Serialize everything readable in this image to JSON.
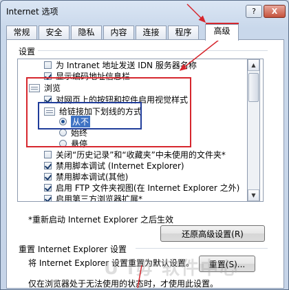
{
  "window": {
    "title": "Internet 选项",
    "help_glyph": "?",
    "close_glyph": "X"
  },
  "tabs": [
    {
      "label": "常规",
      "active": false
    },
    {
      "label": "安全",
      "active": false
    },
    {
      "label": "隐私",
      "active": false
    },
    {
      "label": "内容",
      "active": false
    },
    {
      "label": "连接",
      "active": false
    },
    {
      "label": "程序",
      "active": false
    },
    {
      "label": "高级",
      "active": true
    }
  ],
  "settings": {
    "label": "设置",
    "items": [
      {
        "type": "checkbox",
        "checked": false,
        "label": "为 Intranet 地址发送 IDN 服务器名称"
      },
      {
        "type": "checkbox",
        "checked": true,
        "label": "显示编码地址信息栏"
      },
      {
        "type": "group",
        "label": "浏览"
      },
      {
        "type": "checkbox",
        "checked": true,
        "label": "对网页上的按钮和控件启用视觉样式"
      },
      {
        "type": "group",
        "label": "给链接加下划线的方式"
      },
      {
        "type": "radio",
        "selected": true,
        "label": "从不"
      },
      {
        "type": "radio",
        "selected": false,
        "label": "始终"
      },
      {
        "type": "radio",
        "selected": false,
        "label": "悬停"
      },
      {
        "type": "checkbox",
        "checked": false,
        "label": "关闭“历史记录”和“收藏夹”中未使用的文件夹*"
      },
      {
        "type": "checkbox",
        "checked": true,
        "label": "禁用脚本调试 (Internet Explorer)"
      },
      {
        "type": "checkbox",
        "checked": true,
        "label": "禁用脚本调试(其他)"
      },
      {
        "type": "checkbox",
        "checked": true,
        "label": "启用 FTP 文件夹视图(在 Internet Explorer 之外)"
      },
      {
        "type": "checkbox",
        "checked": true,
        "label": "启用第三方浏览器扩展*"
      }
    ],
    "note": "*重新启动 Internet Explorer 之后生效",
    "restore_button": "还原高级设置(R)"
  },
  "reset": {
    "heading": "重置 Internet Explorer 设置",
    "description": "将 Internet Explorer 设置重置为默认设置。",
    "button": "重置(S)...",
    "footnote": "仅在浏览器处于无法使用的状态时，才使用此设置。"
  },
  "watermark": "U i毋 软件中心",
  "annotation_colors": {
    "red": "#d6262d",
    "blue": "#1f3c9a"
  }
}
